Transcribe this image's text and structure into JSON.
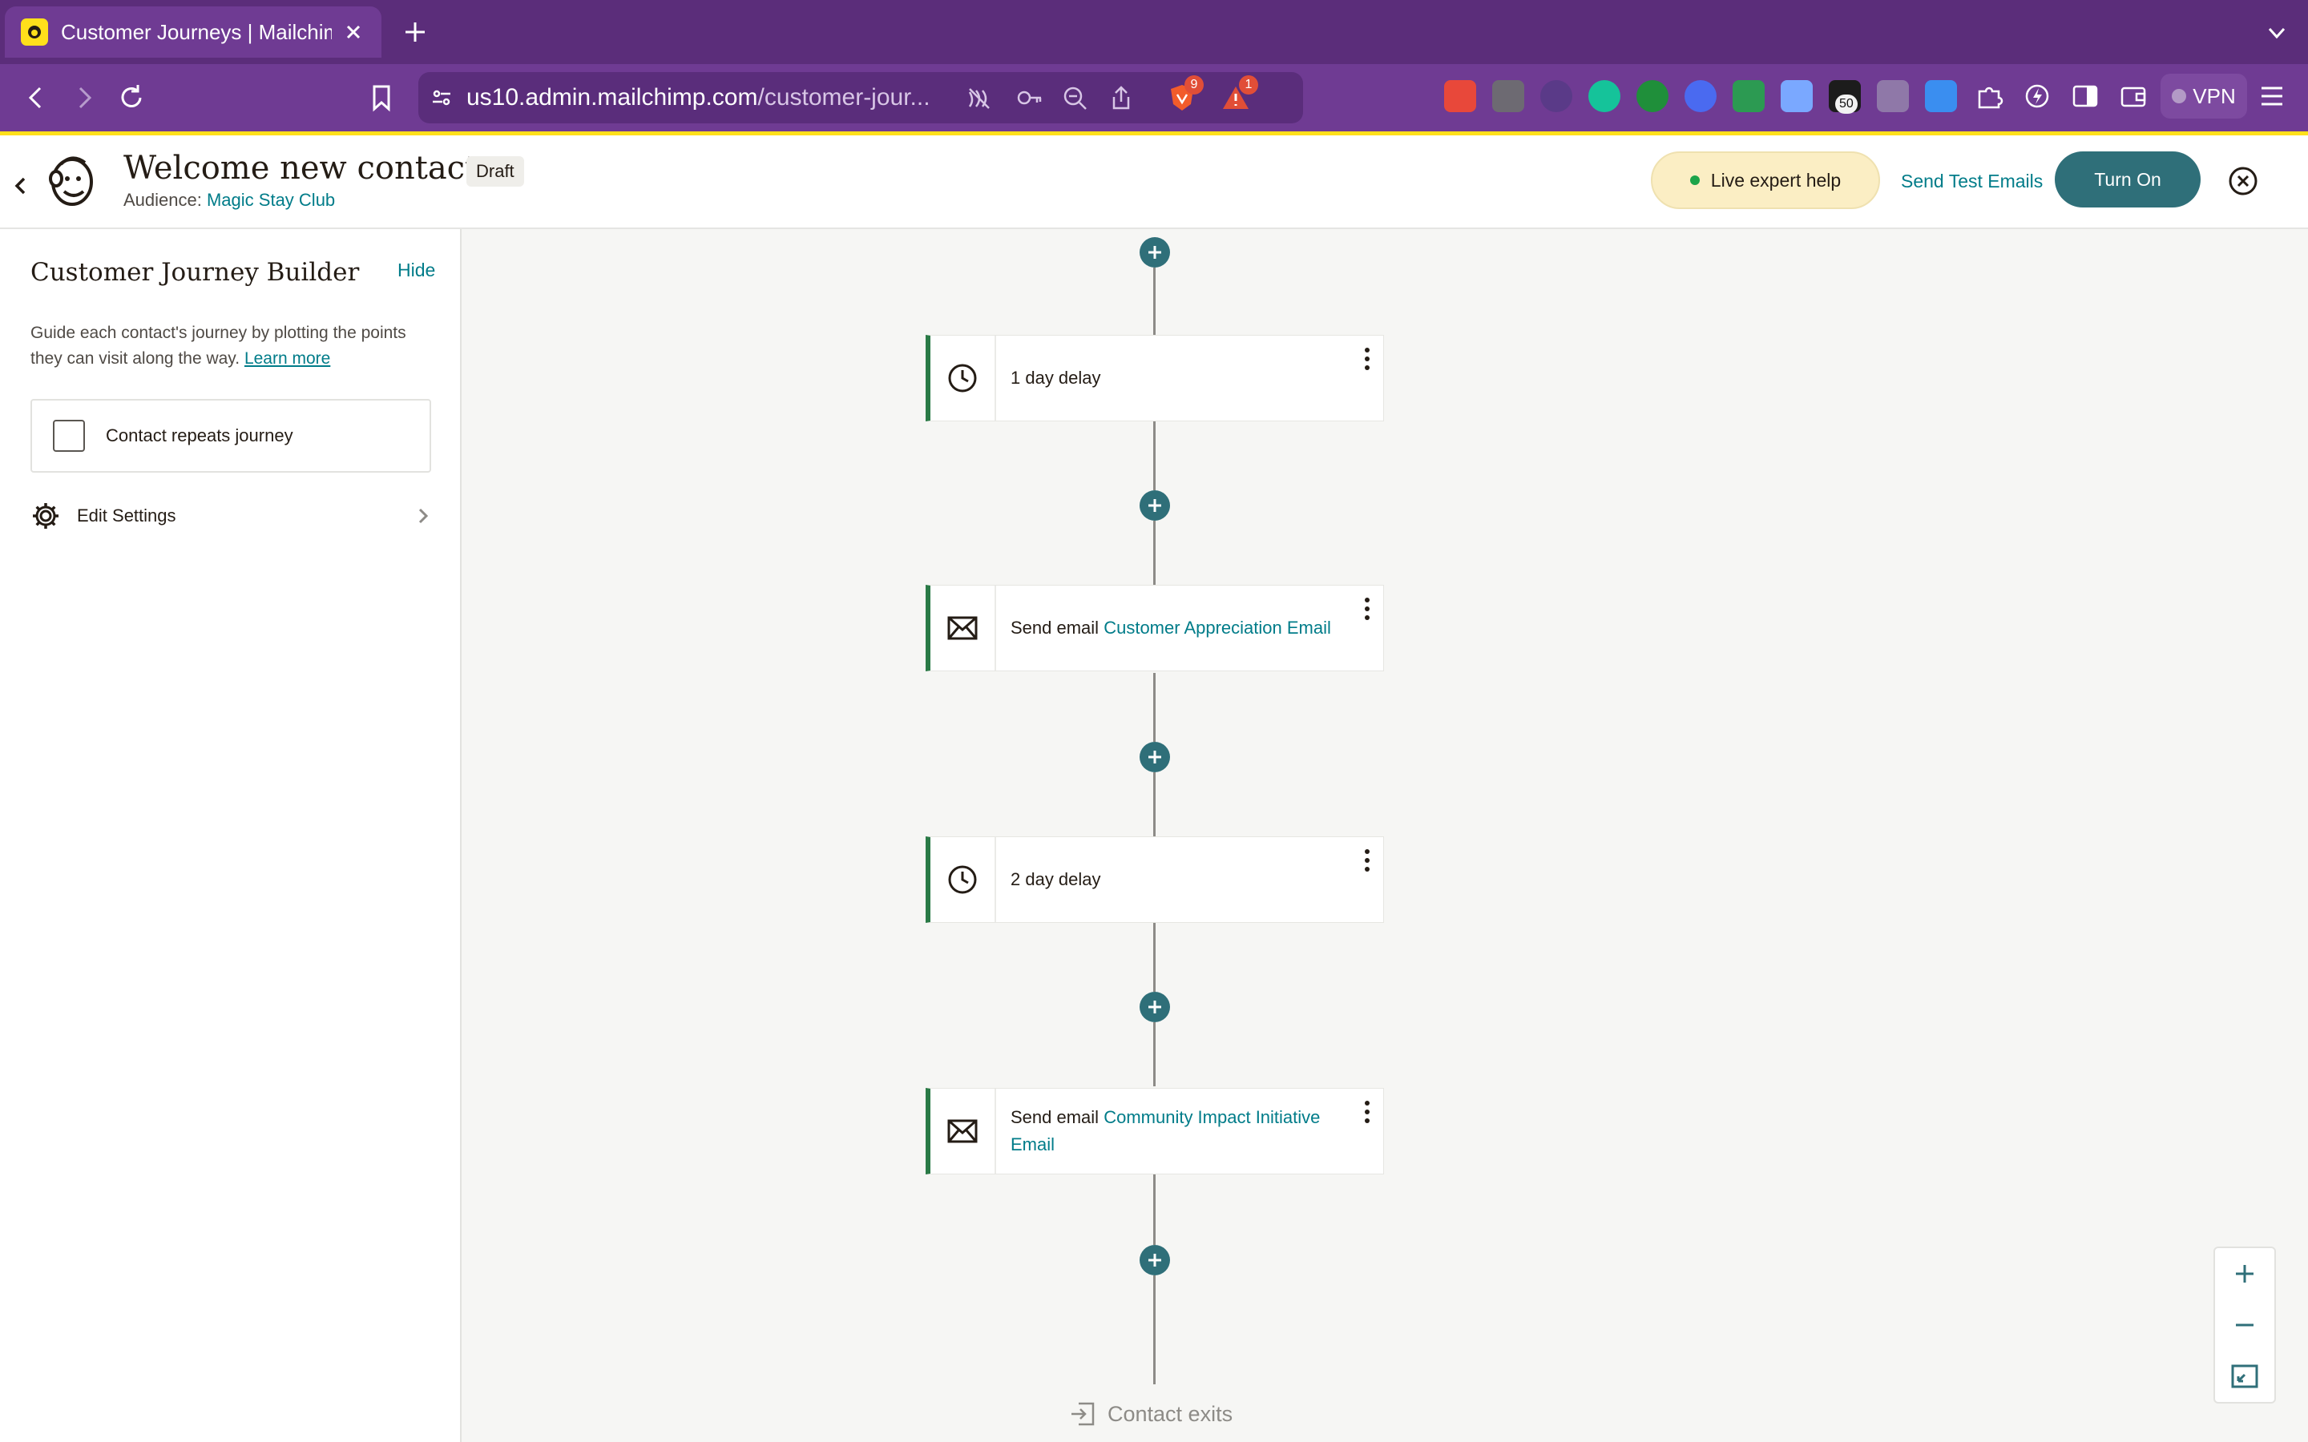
{
  "browser": {
    "tab_title": "Customer Journeys | Mailchimp",
    "url_host": "us10.admin.mailchimp.com",
    "url_path": "/customer-jour...",
    "shield_badge": "9",
    "alert_badge": "1",
    "ext_badge": "50",
    "vpn_label": "VPN"
  },
  "header": {
    "title": "Welcome new contacts",
    "status": "Draft",
    "audience_label": "Audience:",
    "audience_name": "Magic Stay Club",
    "live_help": "Live expert help",
    "send_test": "Send Test Emails",
    "turn_on": "Turn On"
  },
  "sidebar": {
    "title": "Customer Journey Builder",
    "hide": "Hide",
    "guide_text": "Guide each contact's journey by plotting the points they can visit along the way.",
    "learn_more": "Learn more",
    "repeat_label": "Contact repeats journey",
    "edit_settings": "Edit Settings"
  },
  "journey": {
    "steps": [
      {
        "type": "delay",
        "label": "1 day delay"
      },
      {
        "type": "email",
        "label": "Send email",
        "email_name": "Customer Appreciation Email"
      },
      {
        "type": "delay",
        "label": "2 day delay"
      },
      {
        "type": "email",
        "label": "Send email",
        "email_name": "Community Impact Initiative Email"
      }
    ],
    "exit_label": "Contact exits"
  },
  "colors": {
    "brand_purple": "#6f3b93",
    "teal": "#2f6f79",
    "link": "#007c89",
    "step_accent": "#2a7a46",
    "mailchimp_yellow": "#ffe01b"
  }
}
